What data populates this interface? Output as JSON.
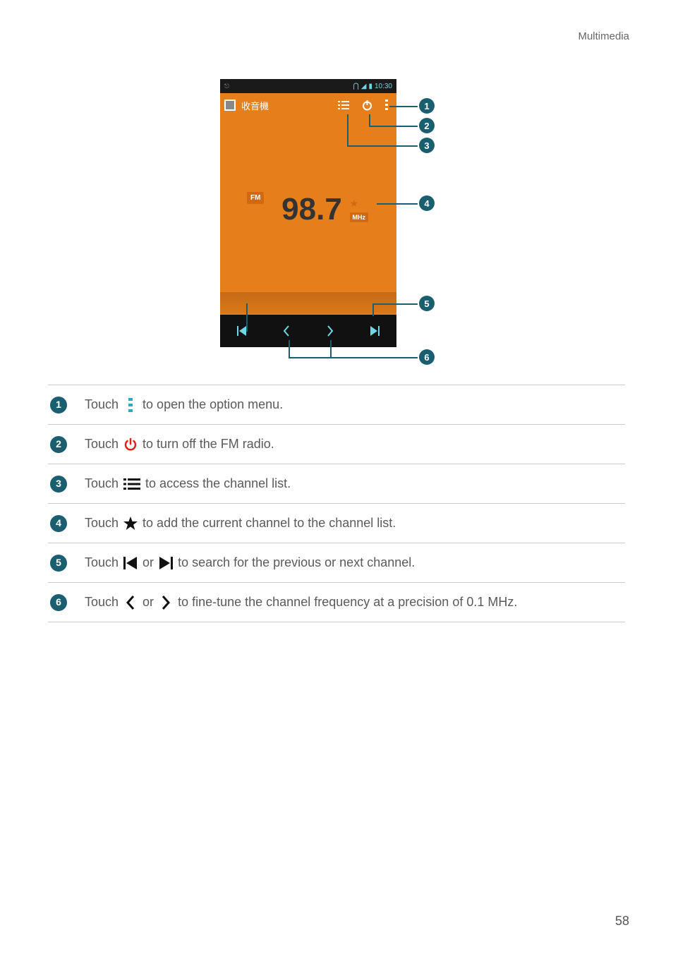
{
  "header": {
    "section": "Multimedia"
  },
  "phone": {
    "status_time": "10:30",
    "toolbar_title": "收音機",
    "fm_label": "FM",
    "frequency": "98.7",
    "unit": "MHz"
  },
  "callouts": {
    "n1": "1",
    "n2": "2",
    "n3": "3",
    "n4": "4",
    "n5": "5",
    "n6": "6"
  },
  "legend": {
    "r1": {
      "num": "1",
      "pre": "Touch ",
      "post": " to open the option menu."
    },
    "r2": {
      "num": "2",
      "pre": "Touch ",
      "post": " to turn off the FM radio."
    },
    "r3": {
      "num": "3",
      "pre": "Touch ",
      "post": "to access the channel list."
    },
    "r4": {
      "num": "4",
      "pre": "Touch ",
      "post": " to add the current channel to the channel list."
    },
    "r5": {
      "num": "5",
      "pre": "Touch ",
      "mid": " or ",
      "post": " to search for the previous or next channel."
    },
    "r6": {
      "num": "6",
      "pre": "Touch  ",
      "mid": " or  ",
      "post": " to fine-tune the channel frequency at a precision of 0.1 MHz."
    }
  },
  "page": {
    "number": "58"
  }
}
